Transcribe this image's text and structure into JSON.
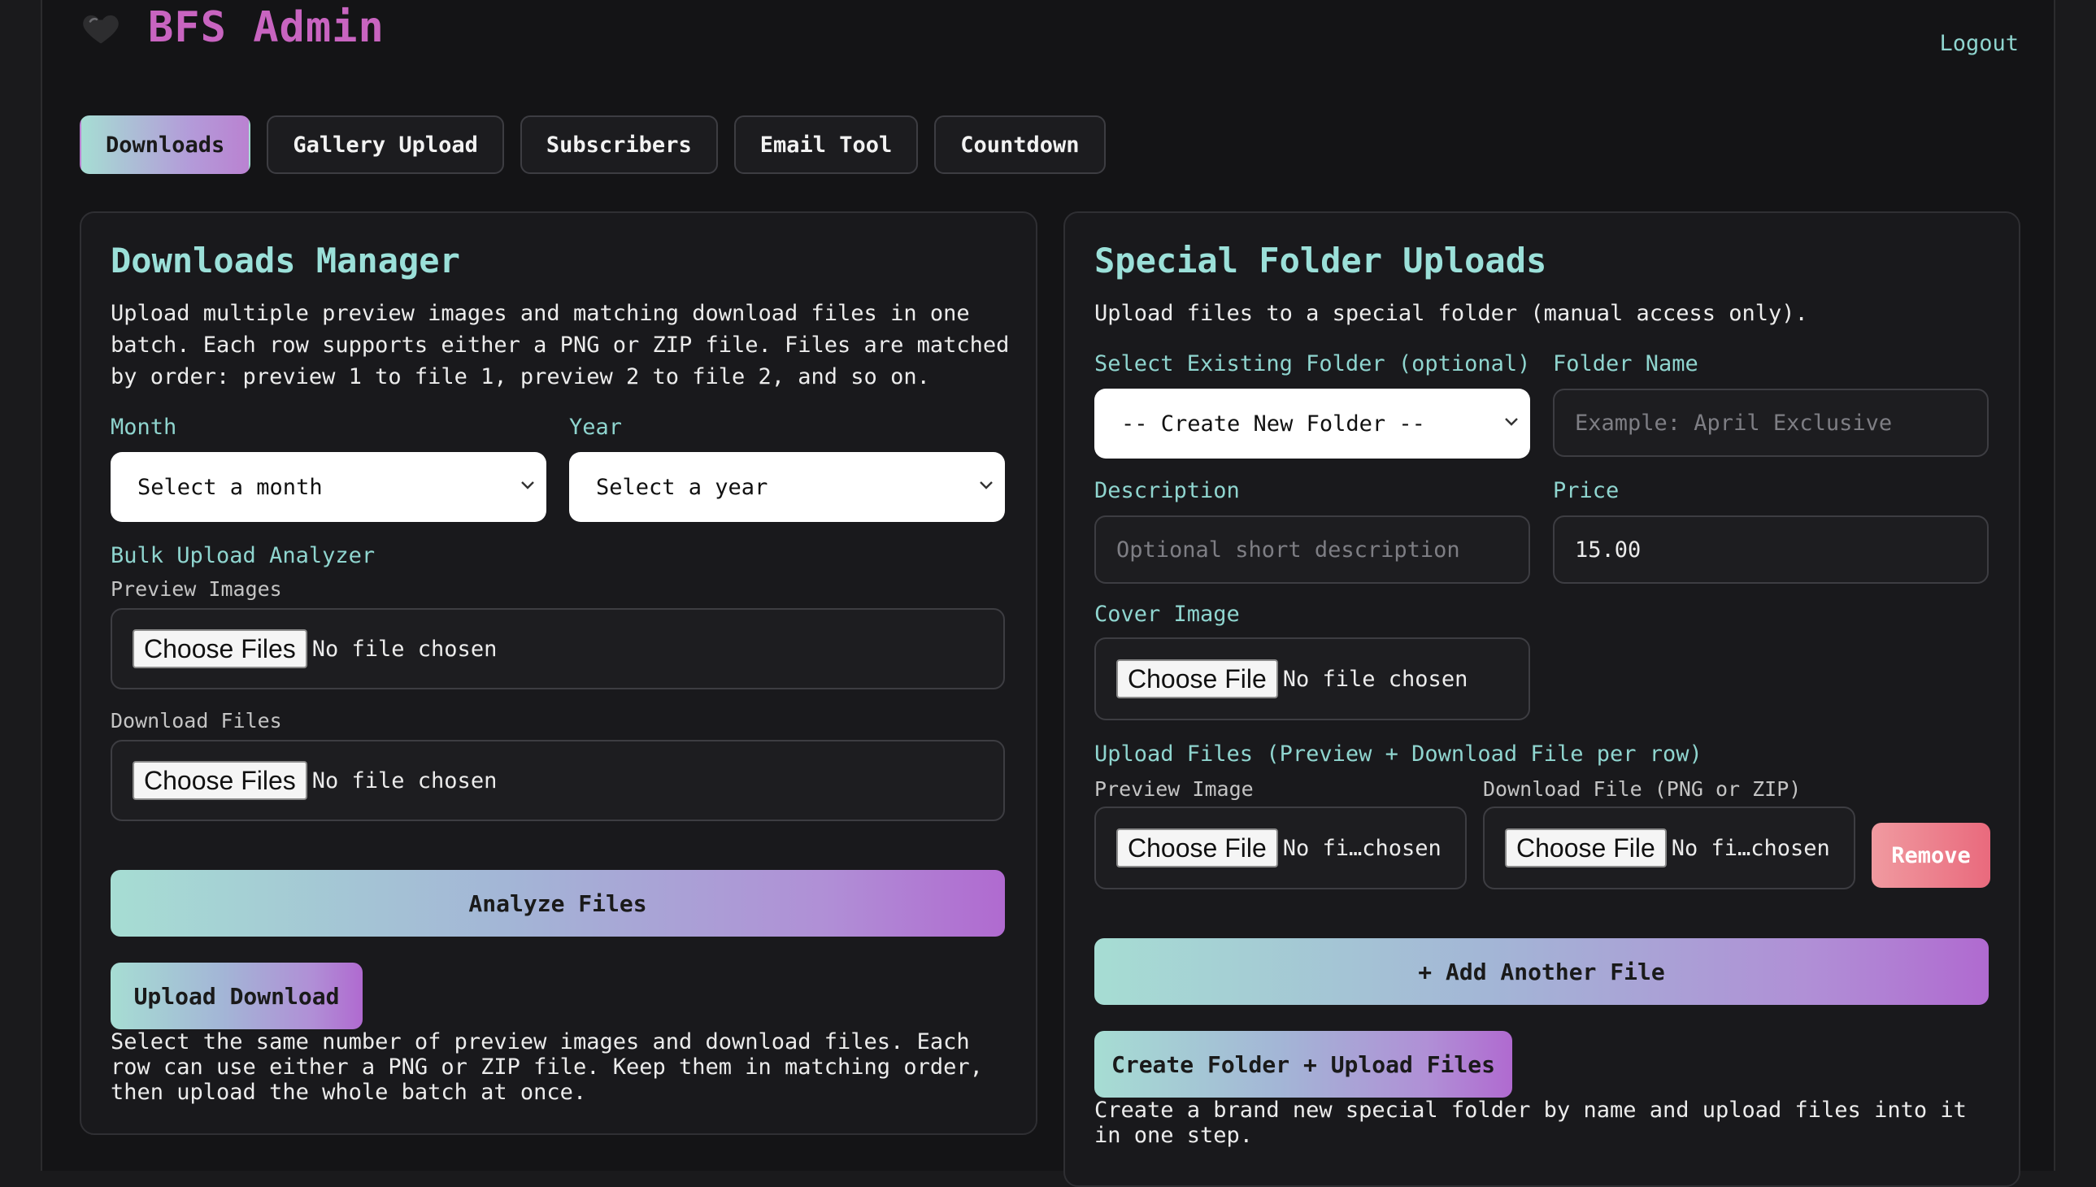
{
  "app": {
    "title": "BFS Admin",
    "logout": "Logout"
  },
  "tabs": [
    {
      "label": "Downloads",
      "active": true
    },
    {
      "label": "Gallery Upload"
    },
    {
      "label": "Subscribers"
    },
    {
      "label": "Email Tool"
    },
    {
      "label": "Countdown"
    }
  ],
  "downloads": {
    "heading": "Downloads Manager",
    "description": [
      "Upload multiple preview images and matching download files in one",
      "batch. Each row supports either a PNG or ZIP file. Files are matched",
      "by order: preview 1 to file 1, preview 2 to file 2, and so on."
    ],
    "month_label": "Month",
    "month_value": "Select a month",
    "year_label": "Year",
    "year_value": "Select a year",
    "bulk_label": "Bulk Upload Analyzer",
    "preview_label": "Preview Images",
    "download_label": "Download Files",
    "choose_files": "Choose Files",
    "no_file": "No file chosen",
    "analyze": "Analyze Files",
    "upload": "Upload Download",
    "note": [
      "Select the same number of preview images and download files. Each",
      "row can use either a PNG or ZIP file. Keep them in matching order,",
      "then upload the whole batch at once."
    ]
  },
  "special": {
    "heading": "Special Folder Uploads",
    "description": "Upload files to a special folder (manual access only).",
    "existing_label": "Select Existing Folder (optional)",
    "existing_value": "-- Create New Folder --",
    "name_label": "Folder Name",
    "name_placeholder": "Example: April Exclusive",
    "desc_label": "Description",
    "desc_placeholder": "Optional short description",
    "price_label": "Price",
    "price_value": "15.00",
    "cover_label": "Cover Image",
    "choose_file": "Choose File",
    "no_file": "No file chosen",
    "no_file_short": "No fi…chosen",
    "files_label": "Upload Files (Preview + Download File per row)",
    "preview_label": "Preview Image",
    "download_label": "Download File (PNG or ZIP)",
    "remove": "Remove",
    "add_another": "+ Add Another File",
    "create": "Create Folder + Upload Files",
    "note": [
      "Create a brand new special folder by name and upload files into it",
      "in one step."
    ]
  }
}
